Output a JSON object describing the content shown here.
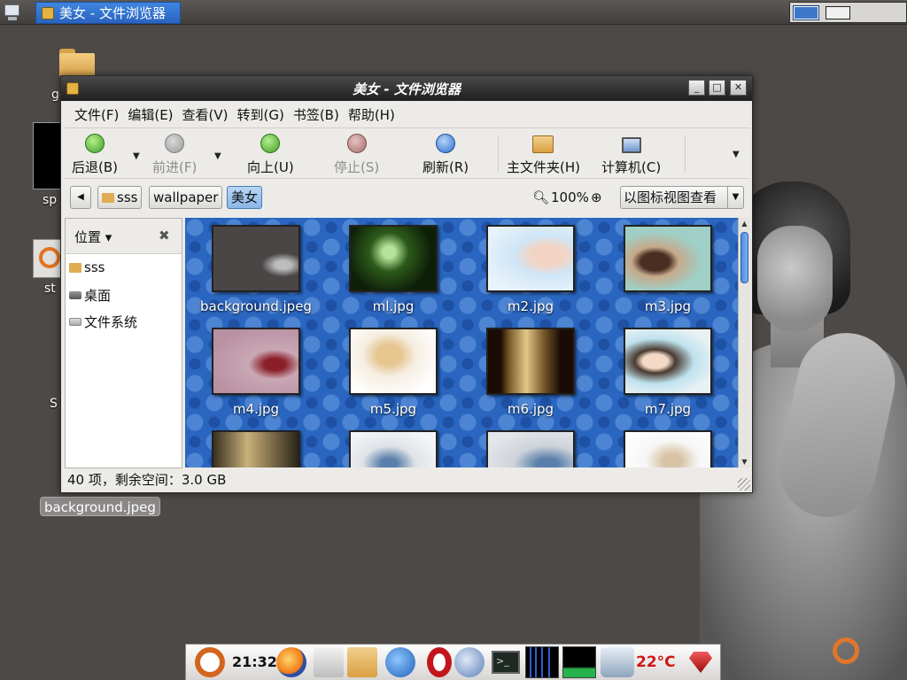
{
  "top_panel": {
    "task_title": "美女 - 文件浏览器"
  },
  "desktop": {
    "icons": [
      {
        "label": "goodm"
      },
      {
        "label": "sp"
      },
      {
        "label": "st"
      },
      {
        "label": "S"
      }
    ],
    "selected_file_label": "background.jpeg"
  },
  "window": {
    "title": "美女 - 文件浏览器",
    "controls": {
      "minimize": "_",
      "maximize": "□",
      "close": "✕"
    },
    "menu": [
      "文件(F)",
      "编辑(E)",
      "查看(V)",
      "转到(G)",
      "书签(B)",
      "帮助(H)"
    ],
    "toolbar": {
      "back": "后退(B)",
      "forward": "前进(F)",
      "up": "向上(U)",
      "stop": "停止(S)",
      "reload": "刷新(R)",
      "home": "主文件夹(H)",
      "computer": "计算机(C)"
    },
    "location": {
      "crumbs": [
        "sss",
        "wallpaper",
        "美女"
      ],
      "zoom": "100%",
      "view_mode": "以图标视图查看"
    },
    "sidebar": {
      "title": "位置",
      "items": [
        "sss",
        "桌面",
        "文件系统"
      ]
    },
    "files": [
      {
        "name": "background.jpeg"
      },
      {
        "name": "ml.jpg"
      },
      {
        "name": "m2.jpg"
      },
      {
        "name": "m3.jpg"
      },
      {
        "name": "m4.jpg"
      },
      {
        "name": "m5.jpg"
      },
      {
        "name": "m6.jpg"
      },
      {
        "name": "m7.jpg"
      }
    ],
    "status": "40 项，剩余空间：3.0 GB"
  },
  "dock": {
    "clock": "21:32",
    "temperature": "22°C",
    "terminal_prompt": ">_"
  }
}
